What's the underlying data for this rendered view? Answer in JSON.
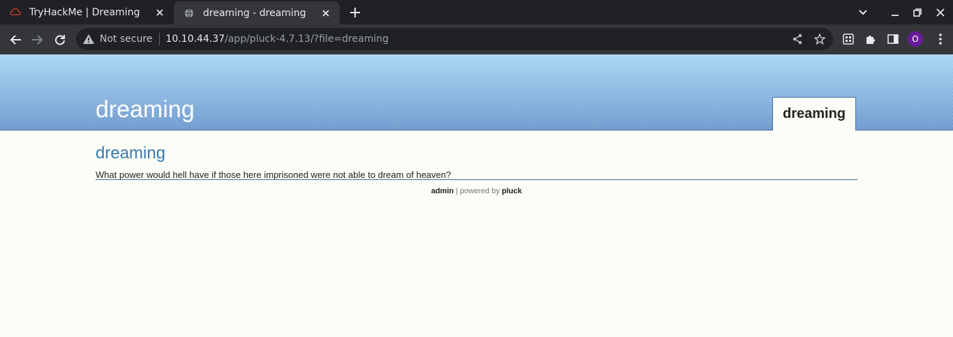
{
  "browser": {
    "tabs": [
      {
        "title": "TryHackMe | Dreaming",
        "icon": "tryhackme-icon",
        "active": false
      },
      {
        "title": "dreaming - dreaming",
        "icon": "globe-icon",
        "active": true
      }
    ],
    "address": {
      "security_label": "Not secure",
      "host": "10.10.44.37",
      "path": "/app/pluck-4.7.13/?file=dreaming"
    },
    "profile_initial": "O",
    "colors": {
      "chrome_dark": "#202124",
      "chrome_toolbar": "#35363a",
      "profile": "#6a1b9a"
    }
  },
  "site": {
    "header_title": "dreaming",
    "menu_item": "dreaming",
    "page_title": "dreaming",
    "page_text": "What power would hell have if those here imprisoned were not able to dream of heaven?",
    "footer": {
      "admin_link": "admin",
      "separator": " | powered by ",
      "pluck_link": "pluck"
    },
    "colors": {
      "background": "#fcfdf7",
      "header_top": "#a6d6f4",
      "header_bottom": "#6c97cd",
      "title_blue": "#3a7ab0"
    }
  }
}
